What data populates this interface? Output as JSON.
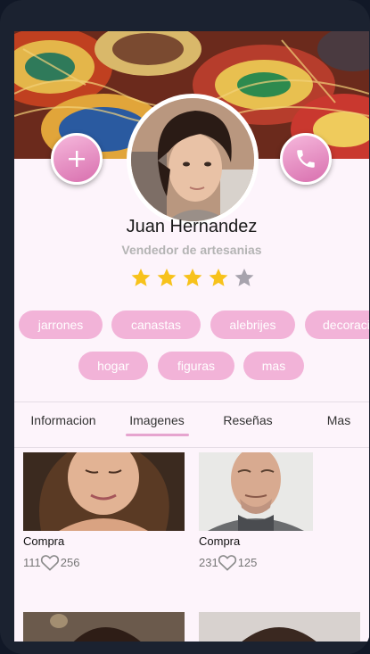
{
  "profile": {
    "name": "Juan Hernandez",
    "role": "Vendedor de artesanias",
    "rating": 4,
    "max_rating": 5
  },
  "actions": {
    "add_icon": "plus-icon",
    "call_icon": "phone-icon"
  },
  "tags": [
    "jarrones",
    "canastas",
    "alebrijes",
    "decoracion",
    "hogar",
    "figuras",
    "mas"
  ],
  "tabs": {
    "active": "Imagenes",
    "items": [
      "Informacion",
      "Imagenes",
      "Reseñas",
      "Mas"
    ]
  },
  "gallery": [
    {
      "title": "Compra",
      "views": "111",
      "likes": "256"
    },
    {
      "title": "Compra",
      "views": "231",
      "likes": "125"
    }
  ],
  "colors": {
    "accent": "#f2b3d8",
    "star_on": "#f7c21b",
    "star_off": "#a7a3ad",
    "background": "#fdf4fb"
  }
}
